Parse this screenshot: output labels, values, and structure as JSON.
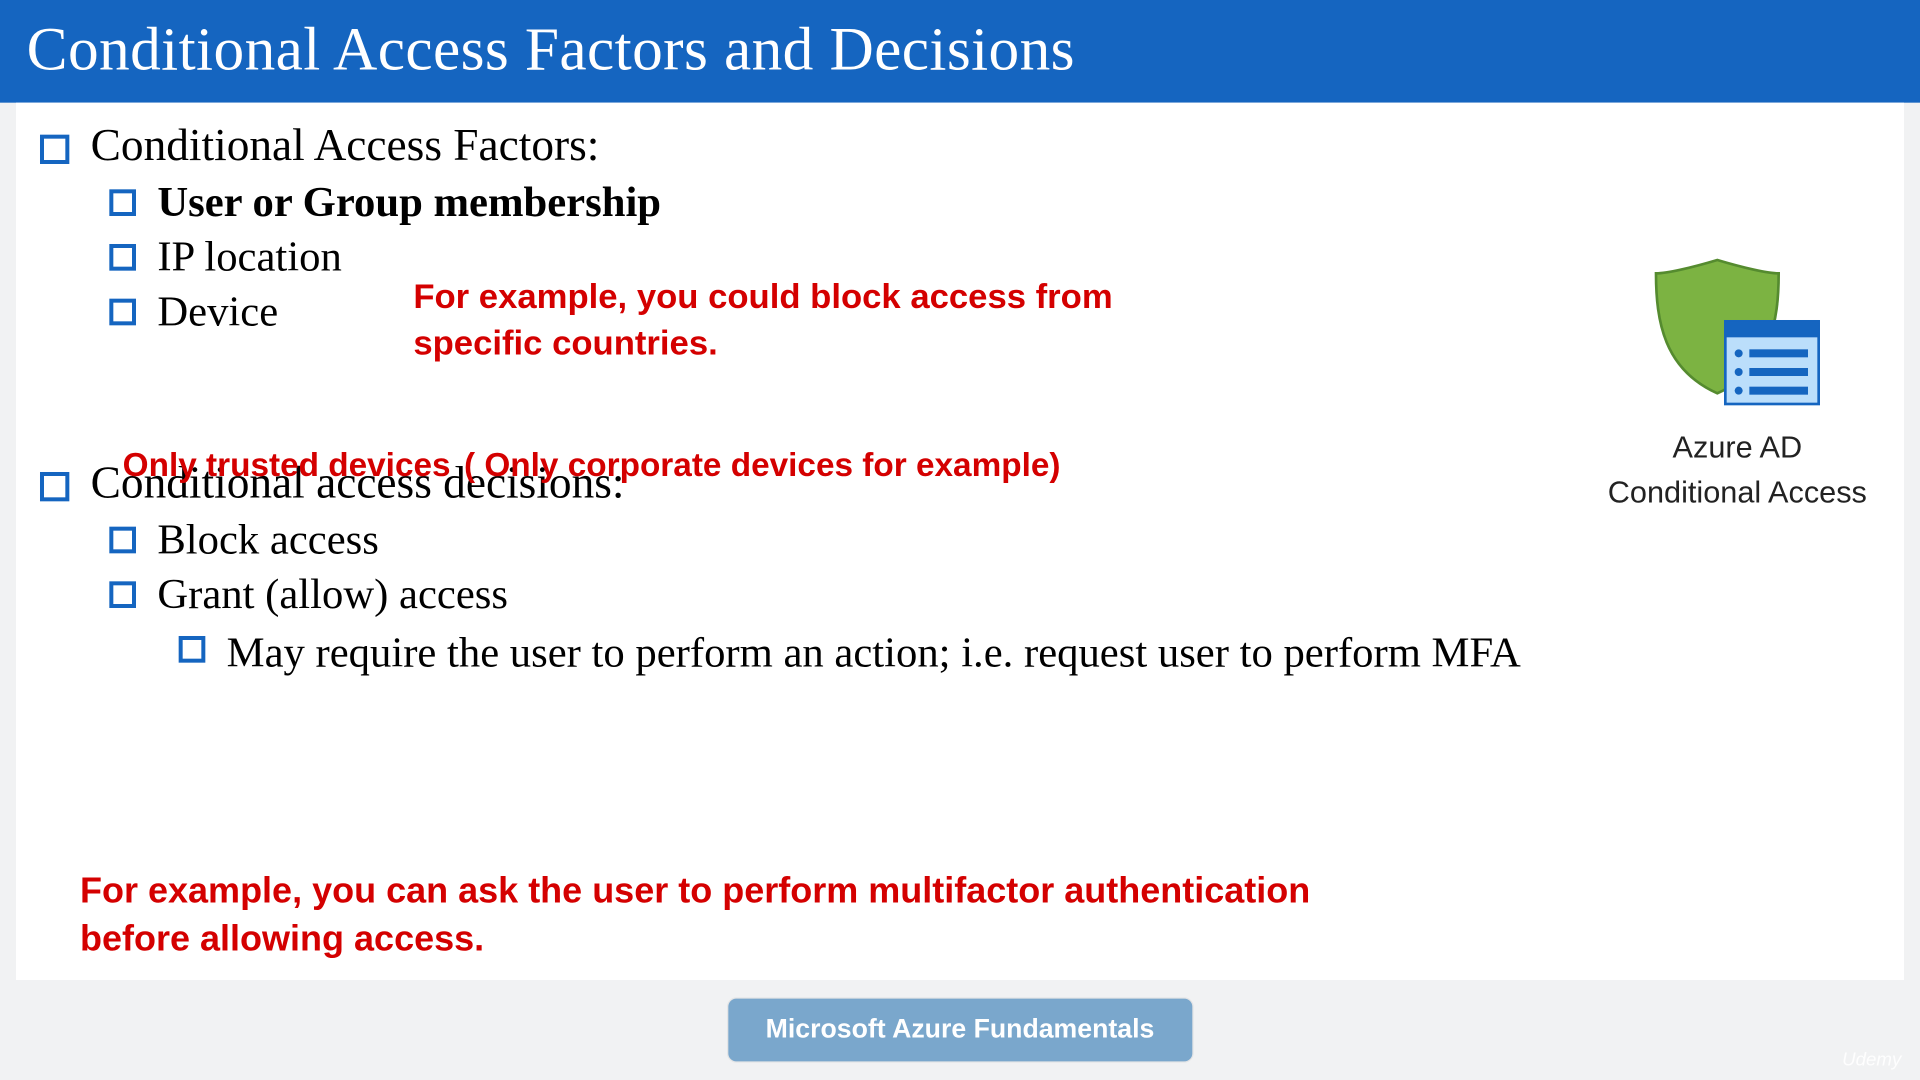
{
  "header": {
    "title": "Conditional Access Factors and Decisions"
  },
  "section1": {
    "title": "Conditional Access Factors:",
    "item1": "User or Group membership",
    "item2": "IP location",
    "item3": "Device"
  },
  "notes": {
    "ip": "For example, you could block access from specific countries.",
    "dev1": "Only trusted devices",
    "dev2": "( Only corporate devices for example)",
    "mfa": "For example, you can ask the user to perform multifactor authentication before allowing access."
  },
  "section2": {
    "title": "Conditional access decisions:",
    "item1": "Block access",
    "item2": "Grant (allow) access",
    "item3": "May require the user to perform an action; i.e. request user to perform MFA"
  },
  "azure": {
    "line1": "Azure AD",
    "line2": "Conditional Access"
  },
  "footer": {
    "pill": "Microsoft Azure Fundamentals"
  },
  "watermark": "Udemy"
}
